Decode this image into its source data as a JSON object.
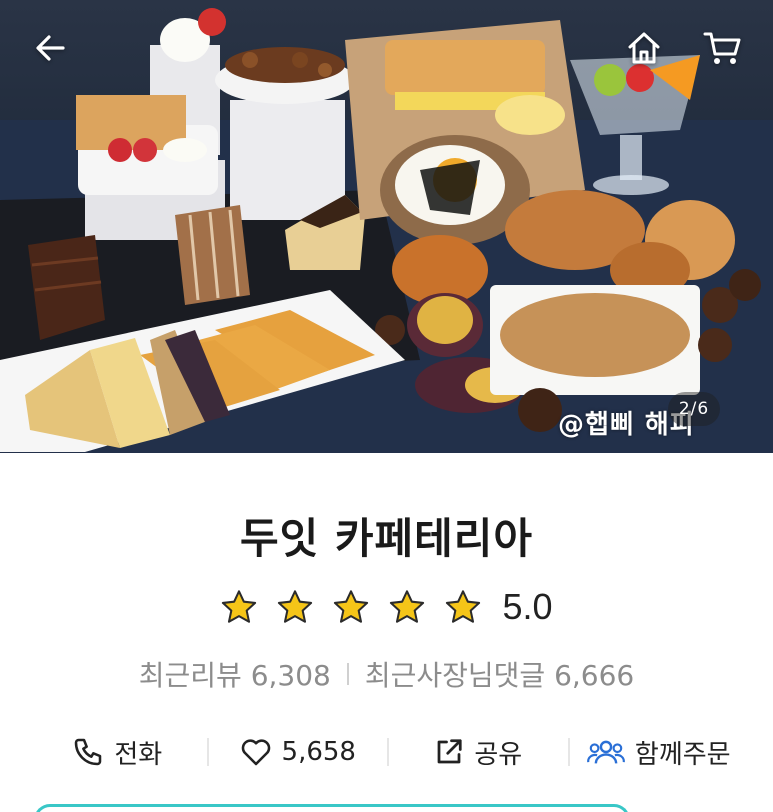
{
  "nav": {
    "back_icon": "arrow-left-icon",
    "home_icon": "home-icon",
    "cart_icon": "cart-icon"
  },
  "gallery": {
    "counter": "2/6",
    "watermark": "@햅삐 해피"
  },
  "store": {
    "name": "두잇 카페테리아",
    "rating": "5.0",
    "star_count": 5,
    "star_color": "#f5c518",
    "recent_reviews_label": "최근리뷰 6,308",
    "owner_replies_label": "최근사장님댓글 6,666"
  },
  "actions": {
    "phone": {
      "icon": "phone-icon",
      "label": "전화"
    },
    "like": {
      "icon": "heart-icon",
      "label": "5,658"
    },
    "share": {
      "icon": "share-icon",
      "label": "공유"
    },
    "group": {
      "icon": "group-icon",
      "label": "함께주문",
      "color": "#2a6fd6"
    }
  },
  "colors": {
    "accent_teal": "#39c7c7"
  }
}
